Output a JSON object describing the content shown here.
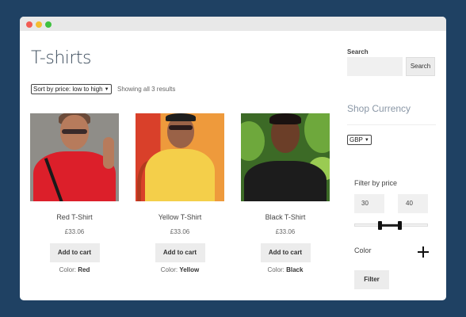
{
  "shop": {
    "page_title": "T-shirts",
    "sort_value": "Sort by price: low to high",
    "result_count": "Showing all 3 results",
    "products": [
      {
        "name": "Red T-Shirt",
        "price": "£33.06",
        "add_to_cart": "Add to cart",
        "color_label": "Color: ",
        "color_value": "Red"
      },
      {
        "name": "Yellow T-Shirt",
        "price": "£33.06",
        "add_to_cart": "Add to cart",
        "color_label": "Color: ",
        "color_value": "Yellow"
      },
      {
        "name": "Black T-Shirt",
        "price": "£33.06",
        "add_to_cart": "Add to cart",
        "color_label": "Color: ",
        "color_value": "Black"
      }
    ]
  },
  "sidebar": {
    "search_label": "Search",
    "search_value": "",
    "search_button": "Search",
    "currency_title": "Shop Currency",
    "currency_value": "GBP",
    "filter_title": "Filter by price",
    "price_min": "30",
    "price_max": "40",
    "color_label": "Color",
    "filter_button": "Filter"
  },
  "icons": {
    "chevron": "chevron-down-icon",
    "plus": "plus-icon"
  }
}
